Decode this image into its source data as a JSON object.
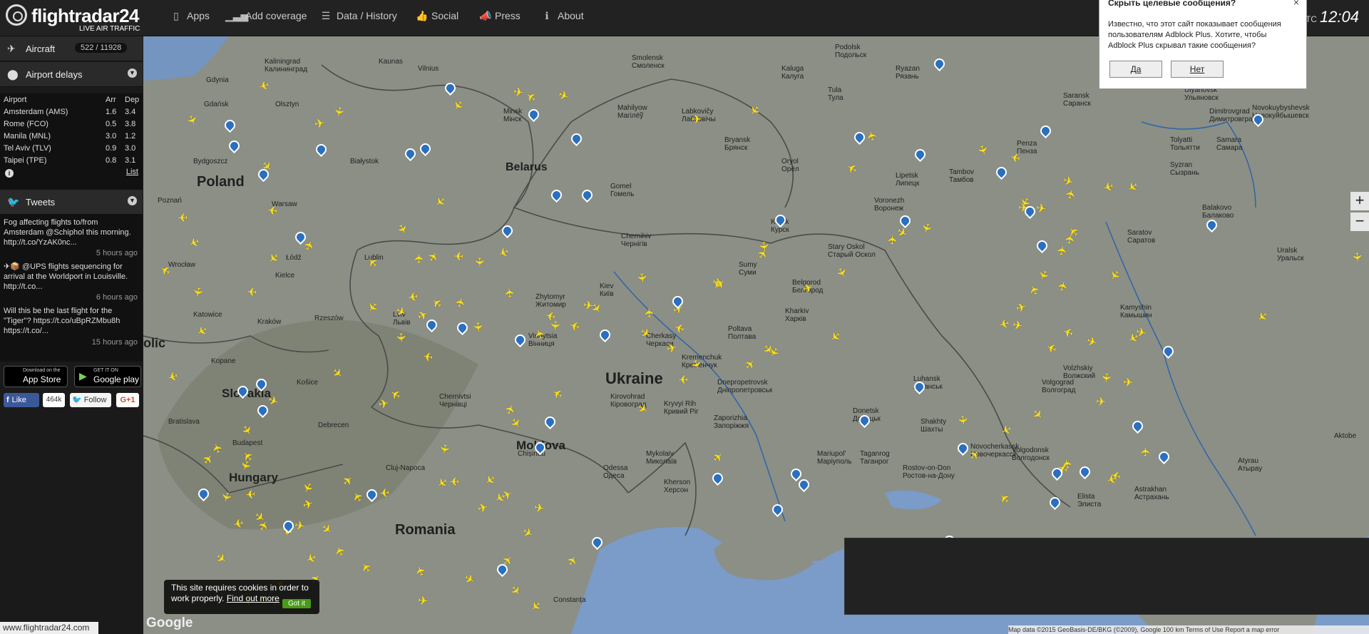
{
  "brand": {
    "name": "flightradar24",
    "tagline": "LIVE AIR TRAFFIC"
  },
  "nav": [
    {
      "label": "Apps",
      "icon": "phone-icon"
    },
    {
      "label": "Add coverage",
      "icon": "signal-bars-icon"
    },
    {
      "label": "Data / History",
      "icon": "database-icon"
    },
    {
      "label": "Social",
      "icon": "thumbs-up-icon"
    },
    {
      "label": "Press",
      "icon": "megaphone-icon"
    },
    {
      "label": "About",
      "icon": "info-icon"
    }
  ],
  "clock": {
    "tz": "UTC",
    "time": "12:04"
  },
  "sidebar": {
    "aircraft_label": "Aircraft",
    "aircraft_count": "522 / 11928",
    "delays_label": "Airport delays",
    "delays_header": {
      "airport": "Airport",
      "arr": "Arr",
      "dep": "Dep"
    },
    "delays": [
      {
        "airport": "Amsterdam (AMS)",
        "arr": "1.6",
        "dep": "3.4"
      },
      {
        "airport": "Rome (FCO)",
        "arr": "0.5",
        "dep": "3.8"
      },
      {
        "airport": "Manila (MNL)",
        "arr": "3.0",
        "dep": "1.2"
      },
      {
        "airport": "Tel Aviv (TLV)",
        "arr": "0.9",
        "dep": "3.0"
      },
      {
        "airport": "Taipei (TPE)",
        "arr": "0.8",
        "dep": "3.1"
      }
    ],
    "list_link": "List",
    "tweets_label": "Tweets",
    "tweets": [
      {
        "text": "Fog affecting flights to/from Amsterdam @Schiphol this morning. http://t.co/YzAK0nc...",
        "time": "5 hours ago"
      },
      {
        "text": "✈📦 @UPS flights sequencing for arrival at the Worldport in Louisville. http://t.co...",
        "time": "6 hours ago"
      },
      {
        "text": "Will this be the last flight for the \"Tiger\"? https://t.co/uBpRZMbu8h https://t.co/...",
        "time": "15 hours ago"
      }
    ],
    "appstore": {
      "small": "Download on the",
      "big": "App Store"
    },
    "googleplay": {
      "small": "GET IT ON",
      "big": "Google play"
    },
    "fb_like": "Like",
    "fb_count": "464k",
    "tw_follow": "Follow",
    "gplus": "G+1",
    "footer_url": "www.flightradar24.com"
  },
  "map": {
    "countries": [
      "Poland",
      "Belarus",
      "Ukraine",
      "Moldova",
      "Romania",
      "Slovakia",
      "Hungary",
      "olic"
    ],
    "cities": [
      {
        "n": "Gdynia"
      },
      {
        "n": "Gdańsk"
      },
      {
        "n": "Kaliningrad\nКалининград"
      },
      {
        "n": "Kaunas"
      },
      {
        "n": "Vilnius"
      },
      {
        "n": "Olsztyn"
      },
      {
        "n": "Bydgoszcz"
      },
      {
        "n": "Białystok"
      },
      {
        "n": "Minsk\nМінск"
      },
      {
        "n": "Smolensk\nСмоленск"
      },
      {
        "n": "Mahilyow\nМагілёў"
      },
      {
        "n": "Labkovičy\nЛабковічы"
      },
      {
        "n": "Kaluga\nКалуга"
      },
      {
        "n": "Tula\nТула"
      },
      {
        "n": "Podolsk\nПодольск"
      },
      {
        "n": "Ryazan\nРязань"
      },
      {
        "n": "Bryansk\nБрянск"
      },
      {
        "n": "Oryol\nОрёл"
      },
      {
        "n": "Lipetsk\nЛипецк"
      },
      {
        "n": "Tambov\nТамбов"
      },
      {
        "n": "Penza\nПенза"
      },
      {
        "n": "Saransk\nСаранск"
      },
      {
        "n": "Ulyanovsk\nУльяновск"
      },
      {
        "n": "Dimitrovgrad\nДимитровград"
      },
      {
        "n": "Tolyatti\nТольятти"
      },
      {
        "n": "Samara\nСамара"
      },
      {
        "n": "Syzran\nСызрань"
      },
      {
        "n": "Novokuybyshevsk\nНовокуйбышевск"
      },
      {
        "n": "Poznań"
      },
      {
        "n": "Warsaw"
      },
      {
        "n": "Łódź"
      },
      {
        "n": "Wrocław"
      },
      {
        "n": "Kielce"
      },
      {
        "n": "Lublin"
      },
      {
        "n": "Katowice"
      },
      {
        "n": "Kraków"
      },
      {
        "n": "Rzeszów"
      },
      {
        "n": "Gomel\nГомель"
      },
      {
        "n": "Chernihiv\nЧернігів"
      },
      {
        "n": "Kursk\nКурск"
      },
      {
        "n": "Voronezh\nВоронеж"
      },
      {
        "n": "Stary Oskol\nСтарый Оскол"
      },
      {
        "n": "Sumy\nСуми"
      },
      {
        "n": "Zhytomyr\nЖитомир"
      },
      {
        "n": "Kiev\nКиїв"
      },
      {
        "n": "Lviv\nЛьвів"
      },
      {
        "n": "Belgorod\nБелгород"
      },
      {
        "n": "Kharkiv\nХарків"
      },
      {
        "n": "Saratov\nСаратов"
      },
      {
        "n": "Balakovo\nБалаково"
      },
      {
        "n": "Uralsk\nУральск"
      },
      {
        "n": "Kamyshin\nКамышин"
      },
      {
        "n": "Cherkasy\nЧеркаси"
      },
      {
        "n": "Poltava\nПолтава"
      },
      {
        "n": "Vinnytsia\nВінниця"
      },
      {
        "n": "Kremenchuk\nКременчук"
      },
      {
        "n": "Dnepropetrovsk\nДніпропетровськ"
      },
      {
        "n": "Luhansk\nЛуганськ"
      },
      {
        "n": "Volzhskiy\nВолжский"
      },
      {
        "n": "Volgograd\nВолгоград"
      },
      {
        "n": "Chernivtsi\nЧернівці"
      },
      {
        "n": "Kirovohrad\nКіровоград"
      },
      {
        "n": "Kryvyi Rih\nКривий Ріг"
      },
      {
        "n": "Zaporizhia\nЗапоріжжя"
      },
      {
        "n": "Donetsk\nДонецьк"
      },
      {
        "n": "Shakhty\nШахты"
      },
      {
        "n": "Novocherkassk\nНовочеркасск"
      },
      {
        "n": "Volgodonsk\nВолгодонск"
      },
      {
        "n": "Košice"
      },
      {
        "n": "Debrecen"
      },
      {
        "n": "Bratislava"
      },
      {
        "n": "Budapest"
      },
      {
        "n": "Cluj-Napoca"
      },
      {
        "n": "Chișinău"
      },
      {
        "n": "Mykolaiv\nМиколаїв"
      },
      {
        "n": "Odessa\nОдеса"
      },
      {
        "n": "Kherson\nХерсон"
      },
      {
        "n": "Mariupol'\nМаріуполь"
      },
      {
        "n": "Taganrog\nТаганрог"
      },
      {
        "n": "Rostov-on-Don\nРостов-на-Дону"
      },
      {
        "n": "Elista\nЭлиста"
      },
      {
        "n": "Astrakhan\nАстрахань"
      },
      {
        "n": "Atyrau\nАтырау"
      },
      {
        "n": "Aktobe"
      },
      {
        "n": "Constanța"
      },
      {
        "n": "Kopane"
      }
    ],
    "plane_count": 160,
    "pin_count": 60,
    "zoom_in": "+",
    "zoom_out": "−",
    "google_logo": "Google",
    "attribution": "Map data ©2015 GeoBasis-DE/BKG (©2009), Google  100 km  Terms of Use  Report a map error"
  },
  "adblock": {
    "title": "Скрыть целевые сообщения?",
    "message": "Известно, что этот сайт показывает сообщения пользователям Adblock Plus. Хотите, чтобы Adblock Plus скрывал такие сообщения?",
    "yes": "Да",
    "no": "Нет",
    "close": "×"
  },
  "cookie": {
    "text": "This site requires cookies in order to work properly.",
    "link": "Find out more",
    "button": "Got it"
  }
}
